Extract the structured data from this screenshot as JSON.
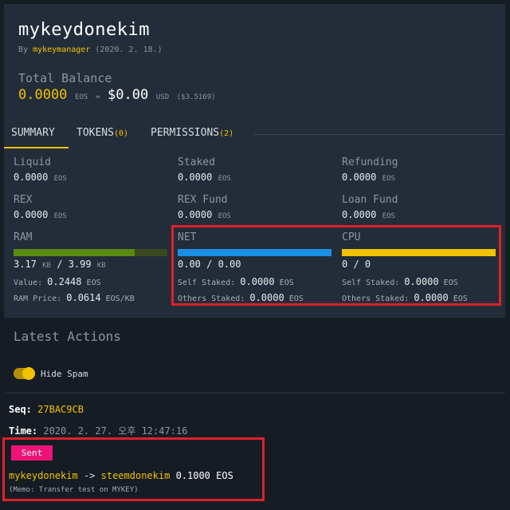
{
  "account": {
    "name": "mykeydonekim",
    "by_prefix": "By",
    "creator": "mykeymanager",
    "created": "(2020. 2. 18.)"
  },
  "balance": {
    "label": "Total Balance",
    "eos_value": "0.0000",
    "eos_unit": "EOS",
    "approx": "≈",
    "usd_value": "$0.00",
    "usd_unit": "USD",
    "price": "($3.5169)"
  },
  "tabs": [
    {
      "label": "SUMMARY",
      "count": ""
    },
    {
      "label": "TOKENS",
      "count": "(0)"
    },
    {
      "label": "PERMISSIONS",
      "count": "(2)"
    }
  ],
  "summary": {
    "liquid": {
      "label": "Liquid",
      "value": "0.0000",
      "unit": "EOS"
    },
    "staked": {
      "label": "Staked",
      "value": "0.0000",
      "unit": "EOS"
    },
    "refunding": {
      "label": "Refunding",
      "value": "0.0000",
      "unit": "EOS"
    },
    "rex": {
      "label": "REX",
      "value": "0.0000",
      "unit": "EOS"
    },
    "rex_fund": {
      "label": "REX Fund",
      "value": "0.0000",
      "unit": "EOS"
    },
    "loan_fund": {
      "label": "Loan Fund",
      "value": "0.0000",
      "unit": "EOS"
    }
  },
  "ram": {
    "label": "RAM",
    "used": "3.17",
    "used_unit": "KB",
    "sep": "/",
    "total": "3.99",
    "total_unit": "KB",
    "fill_percent": 79,
    "bar_color": "#5a8a12",
    "value_label": "Value:",
    "value": "0.2448",
    "value_unit": "EOS",
    "price_label": "RAM Price:",
    "price": "0.0614",
    "price_unit": "EOS/KB"
  },
  "net": {
    "label": "NET",
    "usage": "0.00 / 0.00",
    "fill_percent": 100,
    "bar_color": "#1a8fe3",
    "self_label": "Self Staked:",
    "self_value": "0.0000",
    "others_label": "Others Staked:",
    "others_value": "0.0000",
    "unit": "EOS"
  },
  "cpu": {
    "label": "CPU",
    "usage": "0 / 0",
    "fill_percent": 100,
    "bar_color": "#f2c200",
    "self_label": "Self Staked:",
    "self_value": "0.0000",
    "others_label": "Others Staked:",
    "others_value": "0.0000",
    "unit": "EOS"
  },
  "latest_actions": {
    "title": "Latest Actions",
    "hide_spam": "Hide Spam",
    "seq_label": "Seq:",
    "seq": "27BAC9CB",
    "time_label": "Time:",
    "time": "2020. 2. 27. 오후 12:47:16",
    "badge": "Sent",
    "from": "mykeydonekim",
    "arrow": "->",
    "to": "steemdonekim",
    "amount": "0.1000 EOS",
    "memo": "(Memo: Transfer test on MYKEY)"
  },
  "colors": {
    "accent": "#f2c200",
    "highlight_box": "#e0202a",
    "badge": "#ef1277"
  }
}
